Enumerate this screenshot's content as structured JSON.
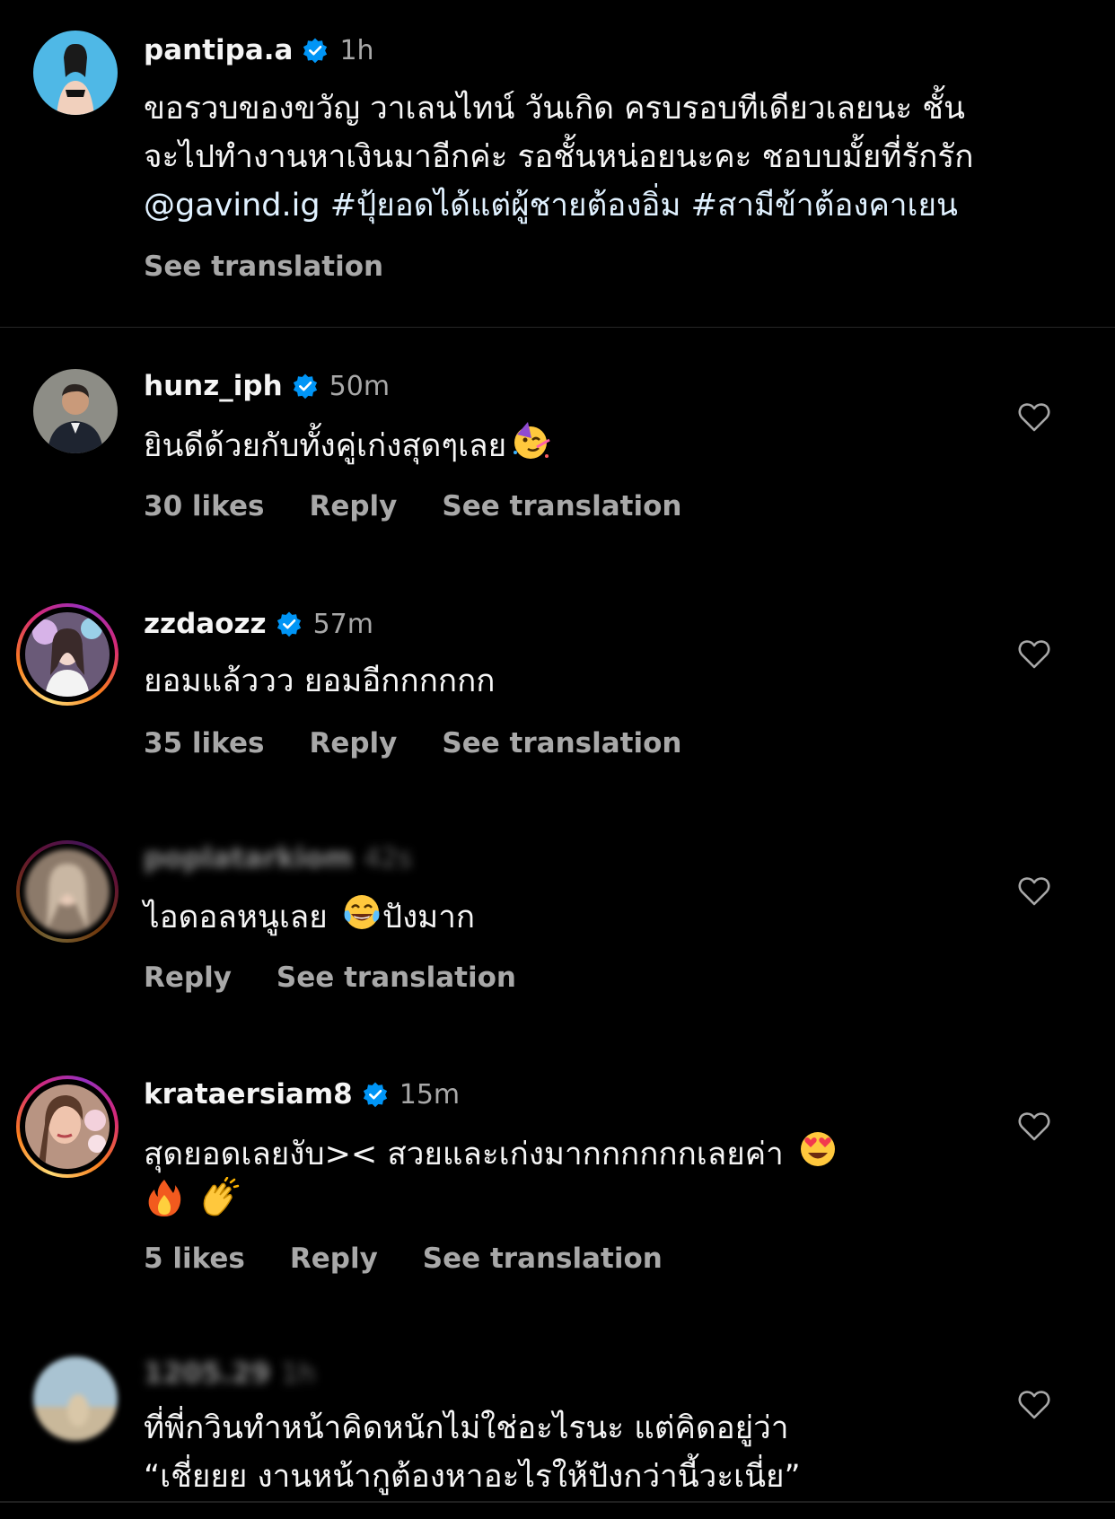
{
  "caption": {
    "username": "pantipa.a",
    "verified": true,
    "time": "1h",
    "lines": [
      "ขอรวบของขวัญ วาเลนไทน์ วันเกิด ครบรอบทีเดียวเลยนะ ชั้น",
      "จะไปทำงานหาเงินมาอีกค่ะ รอชั้นหน่อยนะคะ ชอบบมั้ยที่รักรัก"
    ],
    "mention": "@gavind.ig",
    "hashtags": [
      "#ปุ้ยอดได้แต่ผู้ชายต้องอิ่ม",
      "#สามีข้าต้องคาเยน"
    ],
    "see_translation": "See translation"
  },
  "comments": [
    {
      "username": "hunz_iph",
      "verified": true,
      "time": "50m",
      "text": "ยินดีด้วยกับทั้งคู่เก่งสุดๆเลย",
      "emoji": "partying-face",
      "likes": "30 likes",
      "reply": "Reply",
      "see_translation": "See translation"
    },
    {
      "username": "zzdaozz",
      "verified": true,
      "time": "57m",
      "text": "ยอมแล้ววว ยอมอีกกกกกก",
      "likes": "35 likes",
      "reply": "Reply",
      "see_translation": "See translation"
    },
    {
      "username": "poplatarkiom",
      "verified": false,
      "time": "42s",
      "blurred": true,
      "text_before": "ไอดอลหนูเลย ",
      "emoji": "tears-of-joy",
      "text_after": "ปังมาก",
      "reply": "Reply",
      "see_translation": "See translation"
    },
    {
      "username": "krataersiam8",
      "verified": true,
      "time": "15m",
      "text": "สุดยอดเลยงับ>< สวยและเก่งมากกกกกกเลยค่า",
      "emojis": [
        "heart-eyes",
        "fire",
        "clapping-hands"
      ],
      "likes": "5 likes",
      "reply": "Reply",
      "see_translation": "See translation"
    },
    {
      "username": "1205.29",
      "verified": false,
      "time": "1h",
      "blurred": true,
      "lines": [
        "ที่พี่กวินทำหน้าคิดหนักไม่ใช่อะไรนะ แต่คิดอยู่ว่า",
        "“เชี่ยยย งานหน้ากูต้องหาอะไรให้ปังกว่านี้วะเนี่ย”"
      ]
    }
  ],
  "colors": {
    "background": "#000000",
    "text": "#f5f5f5",
    "secondary": "#a8a8a8",
    "verified_blue": "#0095f6",
    "mention": "#e0f1ff"
  }
}
